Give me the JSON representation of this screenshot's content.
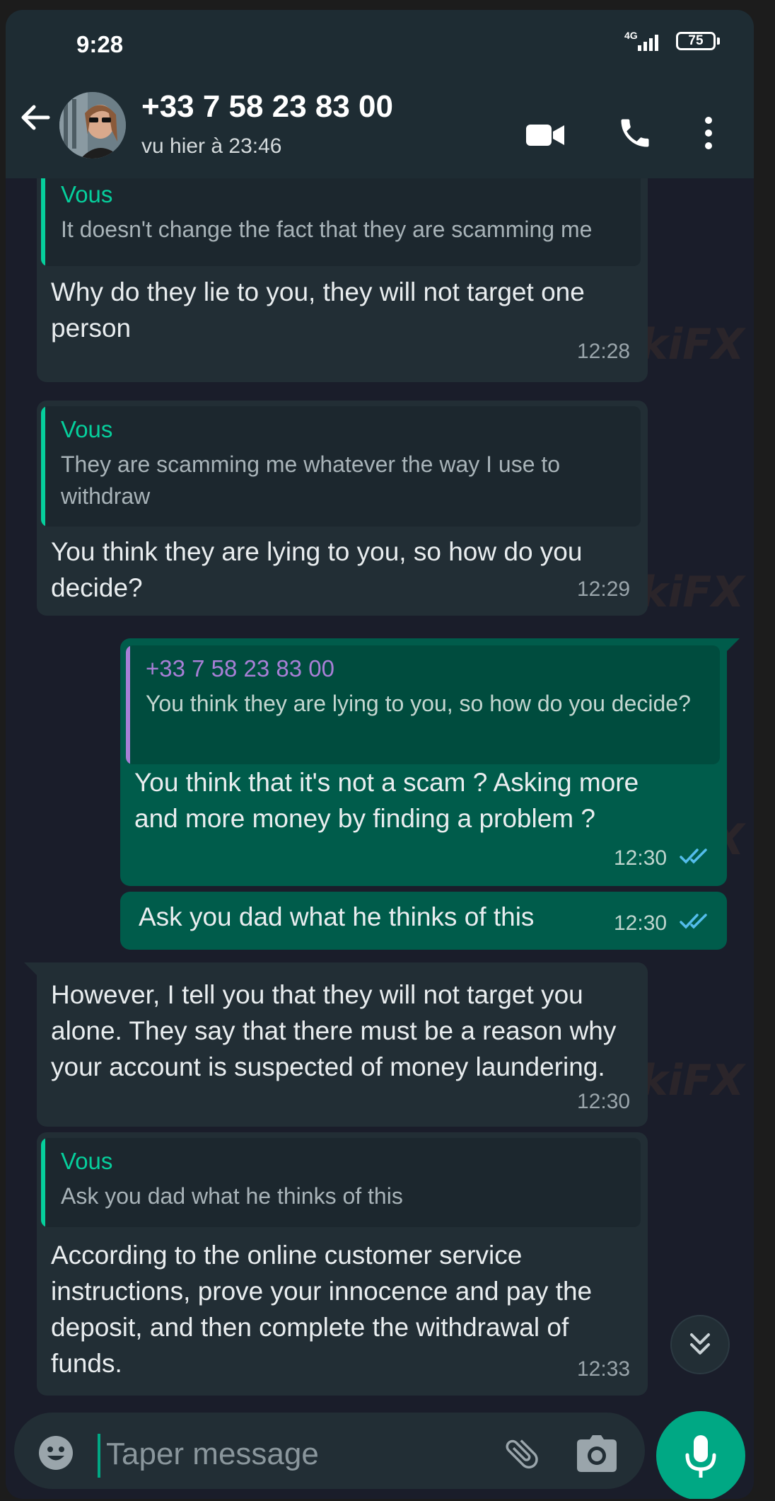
{
  "status_bar": {
    "time": "9:28",
    "network": "4G",
    "battery": "75"
  },
  "header": {
    "contact_name": "+33 7 58 23 83 00",
    "contact_status": "vu hier à 23:46"
  },
  "messages": [
    {
      "direction": "in",
      "quote_author": "Vous",
      "quote_text": "It doesn't change the fact that they are scamming me",
      "text": "Why do they lie to you, they will not target one person",
      "time": "12:28"
    },
    {
      "direction": "in",
      "quote_author": "Vous",
      "quote_text": "They are scamming me whatever the way I use to withdraw",
      "text": "You think they are lying to you, so how do you decide?",
      "time": "12:29"
    },
    {
      "direction": "out",
      "quote_author": "+33 7 58 23 83 00",
      "quote_text": "You think they are lying to you, so how do you decide?",
      "text": "You think that it's not a scam ? Asking more and more money by finding a problem ?",
      "time": "12:30",
      "read": true
    },
    {
      "direction": "out",
      "text": "Ask you dad what he thinks of this",
      "time": "12:30",
      "read": true
    },
    {
      "direction": "in",
      "text": "However, I tell you that they will not target you alone. They say that there must be a reason why your account is suspected of money laundering.",
      "time": "12:30"
    },
    {
      "direction": "in",
      "quote_author": "Vous",
      "quote_text": "Ask you dad what he thinks of this",
      "text": "According to the online customer service instructions, prove your innocence and pay the deposit, and then complete the withdrawal of funds.",
      "time": "12:33"
    }
  ],
  "watermark": "WikiFX",
  "composer": {
    "placeholder": "Taper message"
  },
  "colors": {
    "accent": "#00a884",
    "incoming": "#222e35",
    "outgoing": "#005c4b",
    "quote_self": "#06cf9c",
    "quote_contact": "#a87fd6",
    "read_ticks": "#53bdeb"
  }
}
